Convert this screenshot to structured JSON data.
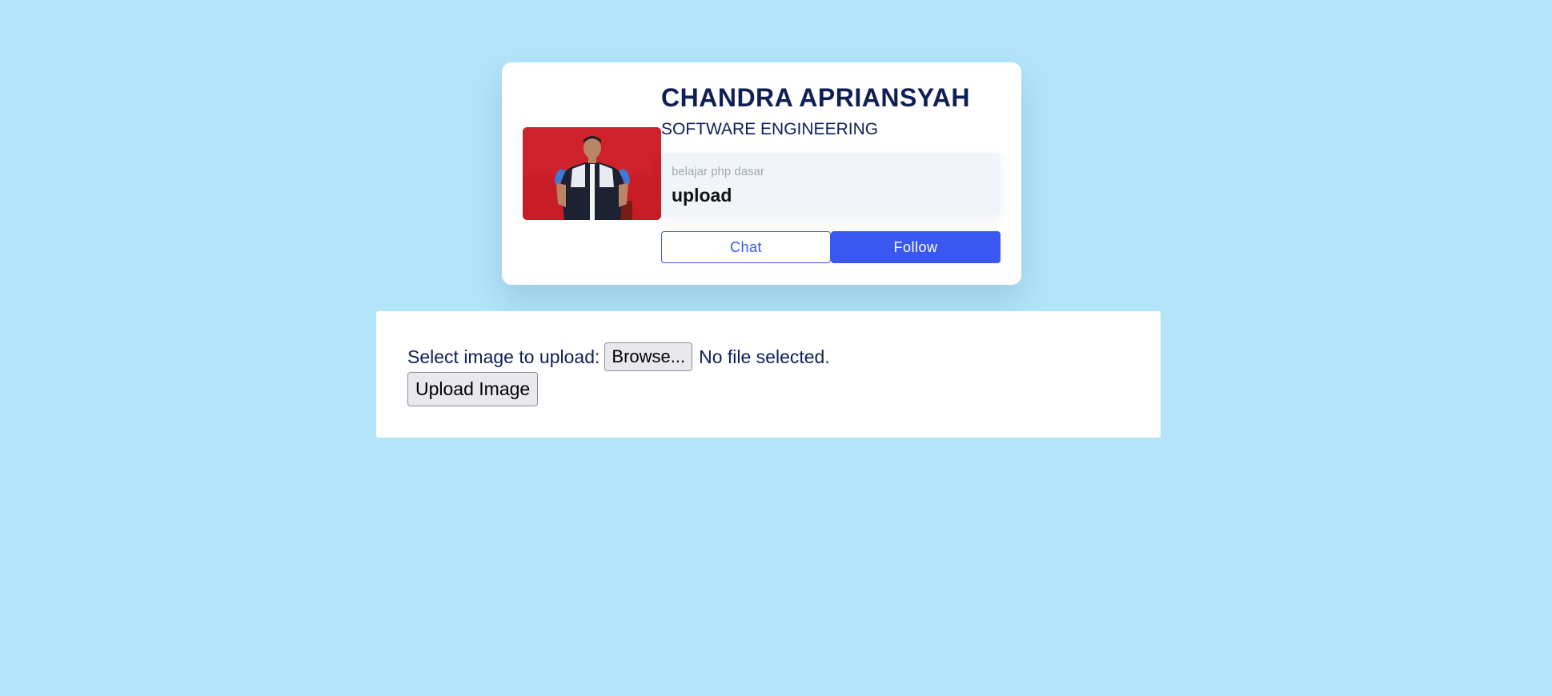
{
  "profile": {
    "name": "CHANDRA APRIANSYAH",
    "role": "SOFTWARE ENGINEERING",
    "stat_label": "belajar php dasar",
    "stat_value": "upload",
    "chat_label": "Chat",
    "follow_label": "Follow"
  },
  "upload": {
    "label": "Select image to upload:",
    "browse_label": "Browse...",
    "file_status": "No file selected.",
    "submit_label": "Upload Image"
  },
  "colors": {
    "page_background": "#b3e4fa",
    "accent": "#3a57f0",
    "heading": "#0e1f55"
  }
}
